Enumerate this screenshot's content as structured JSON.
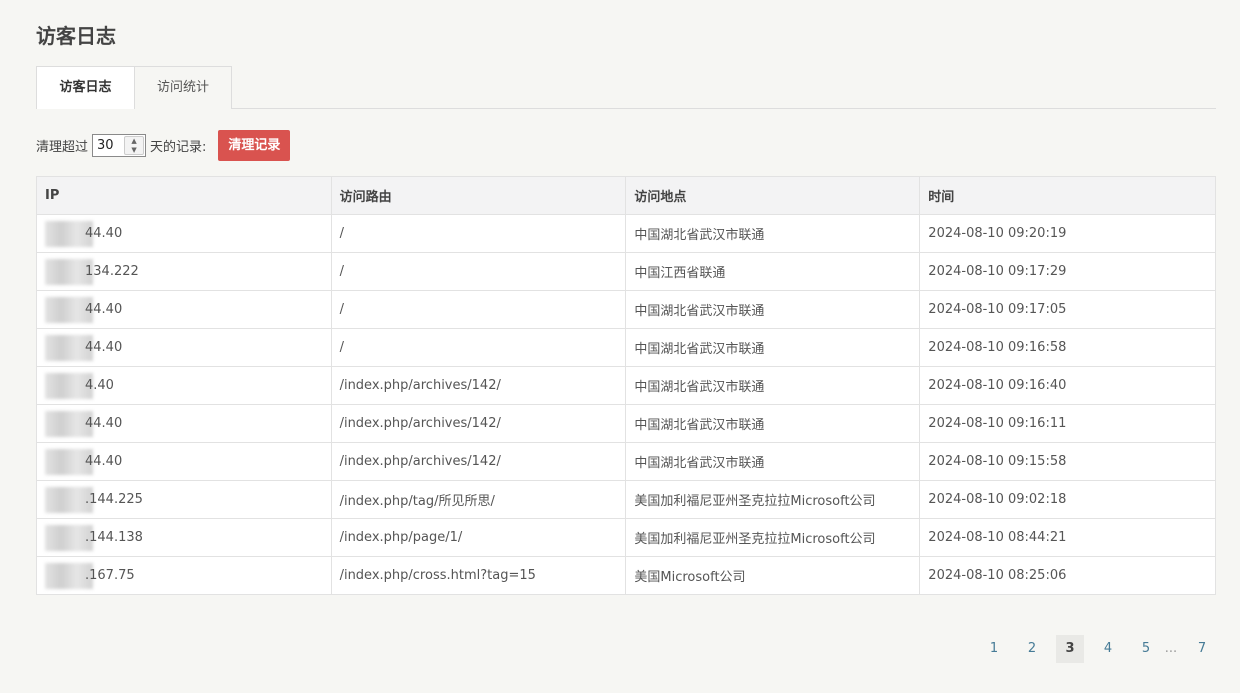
{
  "page_title": "访客日志",
  "tabs": [
    {
      "label": "访客日志",
      "active": true
    },
    {
      "label": "访问统计",
      "active": false
    }
  ],
  "toolbar": {
    "prefix": "清理超过",
    "days_value": "30",
    "suffix": "天的记录:",
    "clear_button": "清理记录"
  },
  "table": {
    "headers": [
      "IP",
      "访问路由",
      "访问地点",
      "时间"
    ],
    "rows": [
      {
        "ip": "44.40",
        "route": "/",
        "location": "中国湖北省武汉市联通",
        "time": "2024-08-10 09:20:19"
      },
      {
        "ip": "134.222",
        "route": "/",
        "location": "中国江西省联通",
        "time": "2024-08-10 09:17:29"
      },
      {
        "ip": "44.40",
        "route": "/",
        "location": "中国湖北省武汉市联通",
        "time": "2024-08-10 09:17:05"
      },
      {
        "ip": "44.40",
        "route": "/",
        "location": "中国湖北省武汉市联通",
        "time": "2024-08-10 09:16:58"
      },
      {
        "ip": "4.40",
        "route": "/index.php/archives/142/",
        "location": "中国湖北省武汉市联通",
        "time": "2024-08-10 09:16:40"
      },
      {
        "ip": "44.40",
        "route": "/index.php/archives/142/",
        "location": "中国湖北省武汉市联通",
        "time": "2024-08-10 09:16:11"
      },
      {
        "ip": "44.40",
        "route": "/index.php/archives/142/",
        "location": "中国湖北省武汉市联通",
        "time": "2024-08-10 09:15:58"
      },
      {
        "ip": ".144.225",
        "route": "/index.php/tag/所见所思/",
        "location": "美国加利福尼亚州圣克拉拉Microsoft公司",
        "time": "2024-08-10 09:02:18"
      },
      {
        "ip": ".144.138",
        "route": "/index.php/page/1/",
        "location": "美国加利福尼亚州圣克拉拉Microsoft公司",
        "time": "2024-08-10 08:44:21"
      },
      {
        "ip": ".167.75",
        "route": "/index.php/cross.html?tag=15",
        "location": "美国Microsoft公司",
        "time": "2024-08-10 08:25:06"
      }
    ]
  },
  "pagination": {
    "pages": [
      "1",
      "2",
      "3",
      "4",
      "5",
      "...",
      "7"
    ],
    "current": "3"
  },
  "colors": {
    "background": "#f6f6f3",
    "danger_button": "#d9534f",
    "link": "#467b96"
  }
}
